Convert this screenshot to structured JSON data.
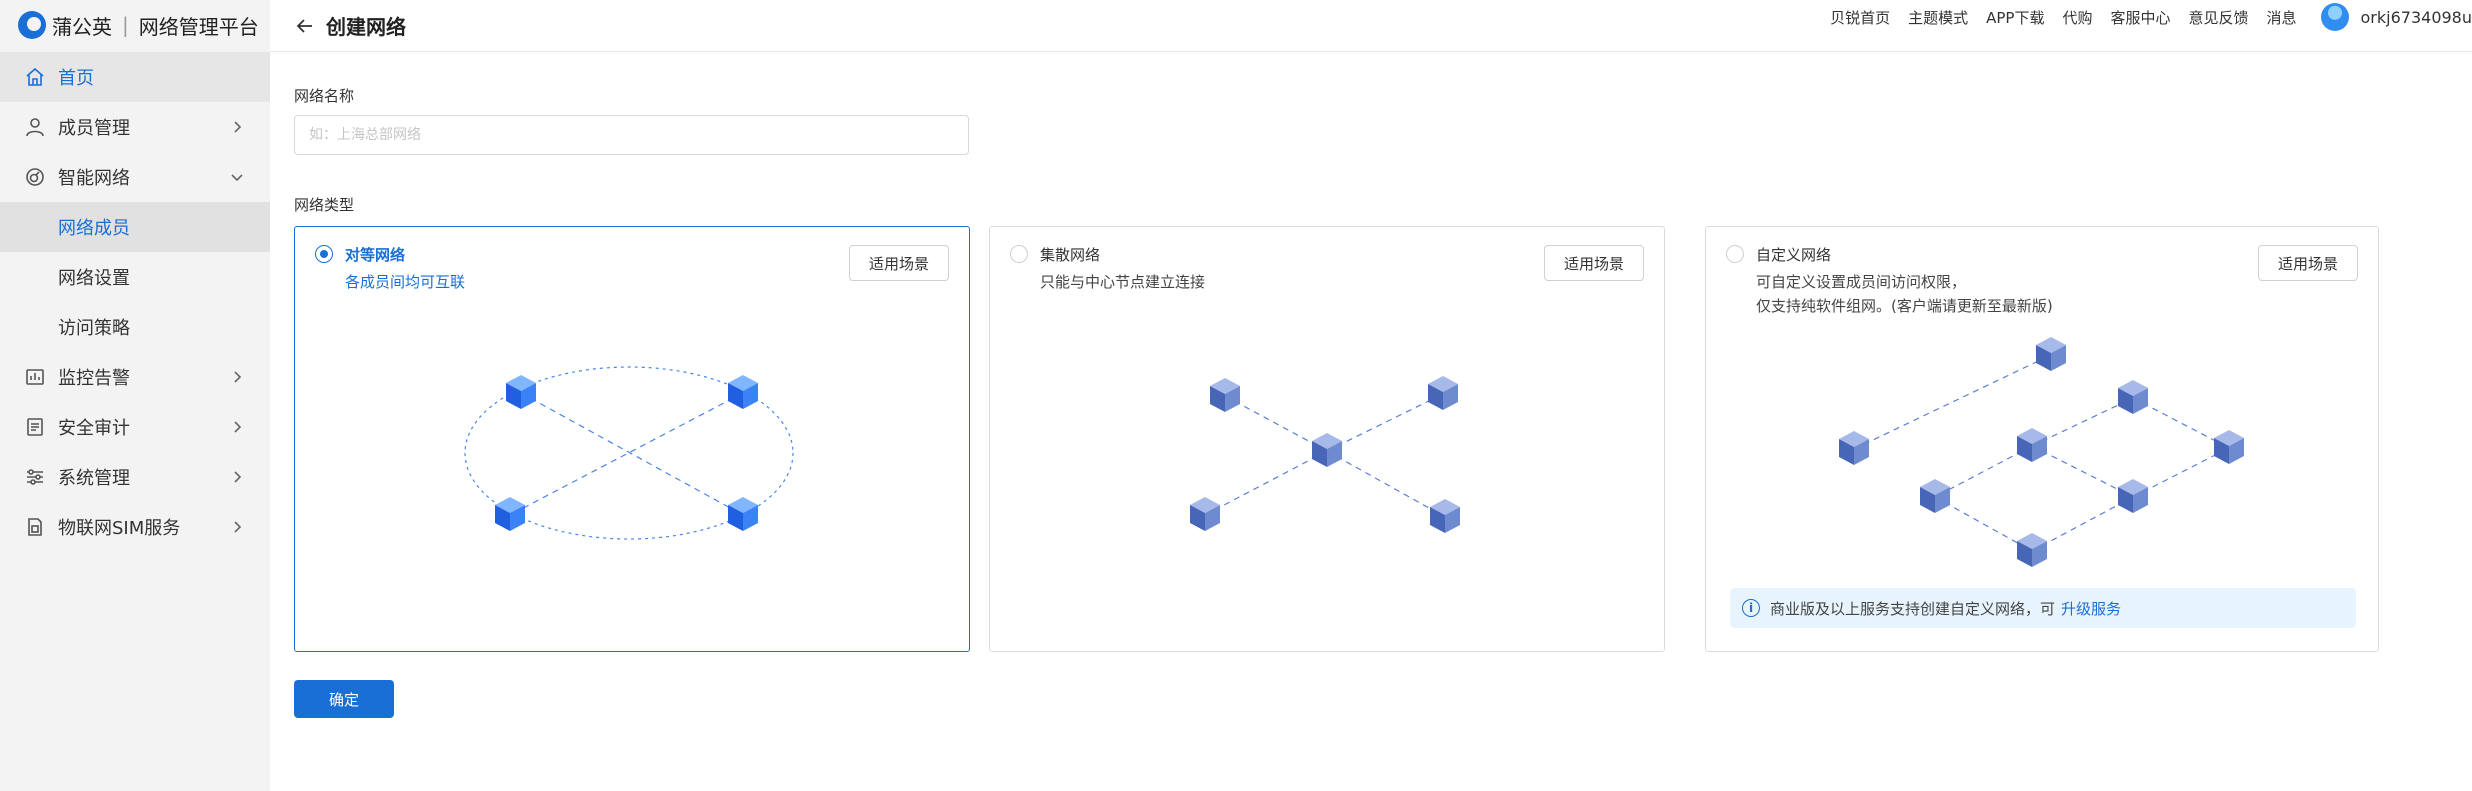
{
  "brand": {
    "name": "蒲公英",
    "product": "网络管理平台"
  },
  "sidebar": {
    "items": [
      {
        "label": "首页",
        "icon": "home-icon",
        "active": true
      },
      {
        "label": "成员管理",
        "icon": "user-icon"
      },
      {
        "label": "智能网络",
        "icon": "network-icon",
        "expanded": true
      },
      {
        "label": "网络成员",
        "sub": true,
        "active": true
      },
      {
        "label": "网络设置",
        "sub": true
      },
      {
        "label": "访问策略",
        "sub": true
      },
      {
        "label": "监控告警",
        "icon": "chart-icon"
      },
      {
        "label": "安全审计",
        "icon": "audit-icon"
      },
      {
        "label": "系统管理",
        "icon": "settings-sliders-icon"
      },
      {
        "label": "物联网SIM服务",
        "icon": "sim-icon"
      }
    ]
  },
  "header": {
    "title": "创建网络",
    "links": [
      "贝锐首页",
      "主题模式",
      "APP下载",
      "代购",
      "客服中心",
      "意见反馈",
      "消息"
    ],
    "username": "orkj6734098u"
  },
  "form": {
    "name_label": "网络名称",
    "name_placeholder": "如：上海总部网络",
    "type_label": "网络类型",
    "scene_button": "适用场景",
    "types": [
      {
        "title": "对等网络",
        "desc": "各成员间均可互联",
        "selected": true
      },
      {
        "title": "集散网络",
        "desc": "只能与中心节点建立连接",
        "selected": false
      },
      {
        "title": "自定义网络",
        "desc1": "可自定义设置成员间访问权限，",
        "desc2": "仅支持纯软件组网。(客户端请更新至最新版)",
        "selected": false
      }
    ],
    "notice_text": "商业版及以上服务支持创建自定义网络，可",
    "notice_link": "升级服务",
    "confirm": "确定"
  },
  "colors": {
    "accent": "#1a6fd6",
    "sidebar_bg": "#f3f3f3"
  }
}
